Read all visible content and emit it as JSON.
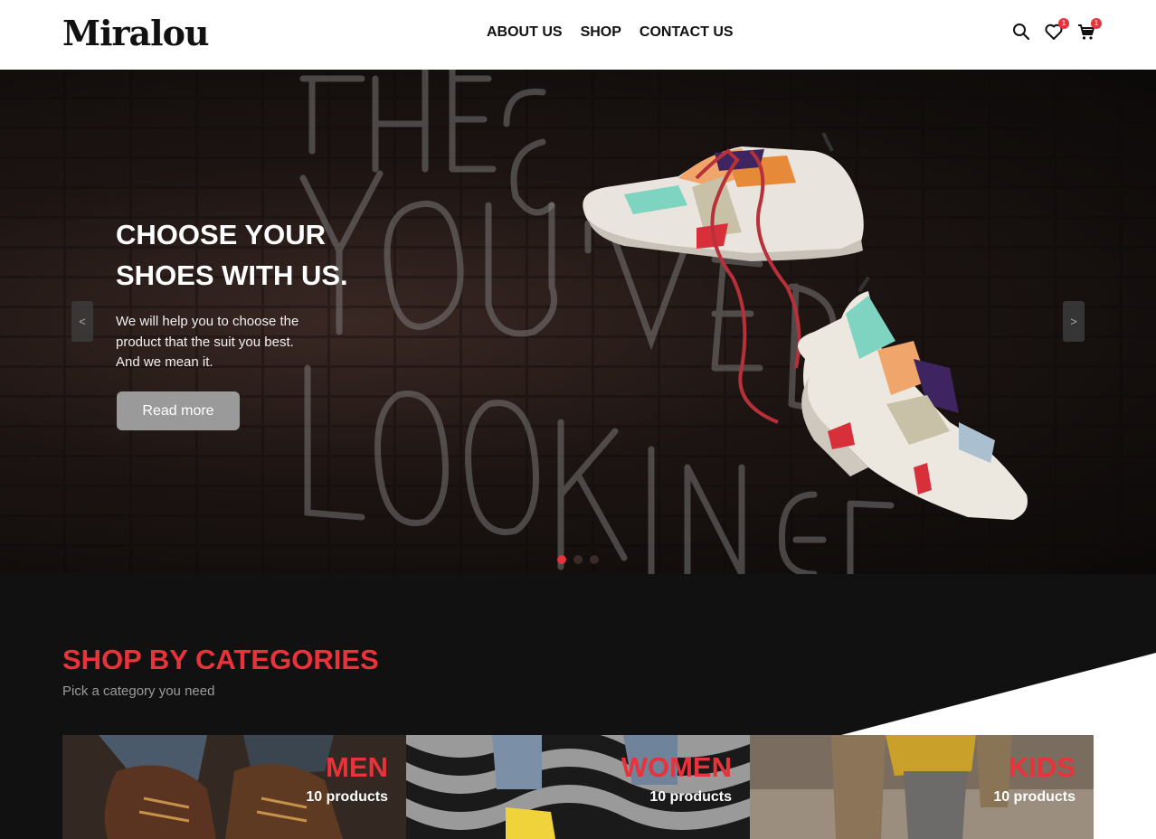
{
  "header": {
    "logo": "Miralou",
    "nav": [
      "ABOUT US",
      "SHOP",
      "CONTACT US"
    ],
    "wishlist_count": "1",
    "cart_count": "1"
  },
  "hero": {
    "title_line1": "CHOOSE YOUR",
    "title_line2": "SHOES WITH US.",
    "text_line1": "We will help you to choose the",
    "text_line2": "product that the suit you best.",
    "text_line3": "And we mean it.",
    "button": "Read more",
    "prev_arrow": "<",
    "next_arrow": ">",
    "active_slide": 1,
    "slide_count": 3
  },
  "categories": {
    "title": "SHOP BY CATEGORIES",
    "subtitle": "Pick a category you need",
    "items": [
      {
        "name": "MEN",
        "count": "10 products"
      },
      {
        "name": "WOMEN",
        "count": "10 products"
      },
      {
        "name": "KIDS",
        "count": "10 products"
      }
    ]
  },
  "colors": {
    "accent": "#e8323c",
    "dark": "#111111"
  }
}
